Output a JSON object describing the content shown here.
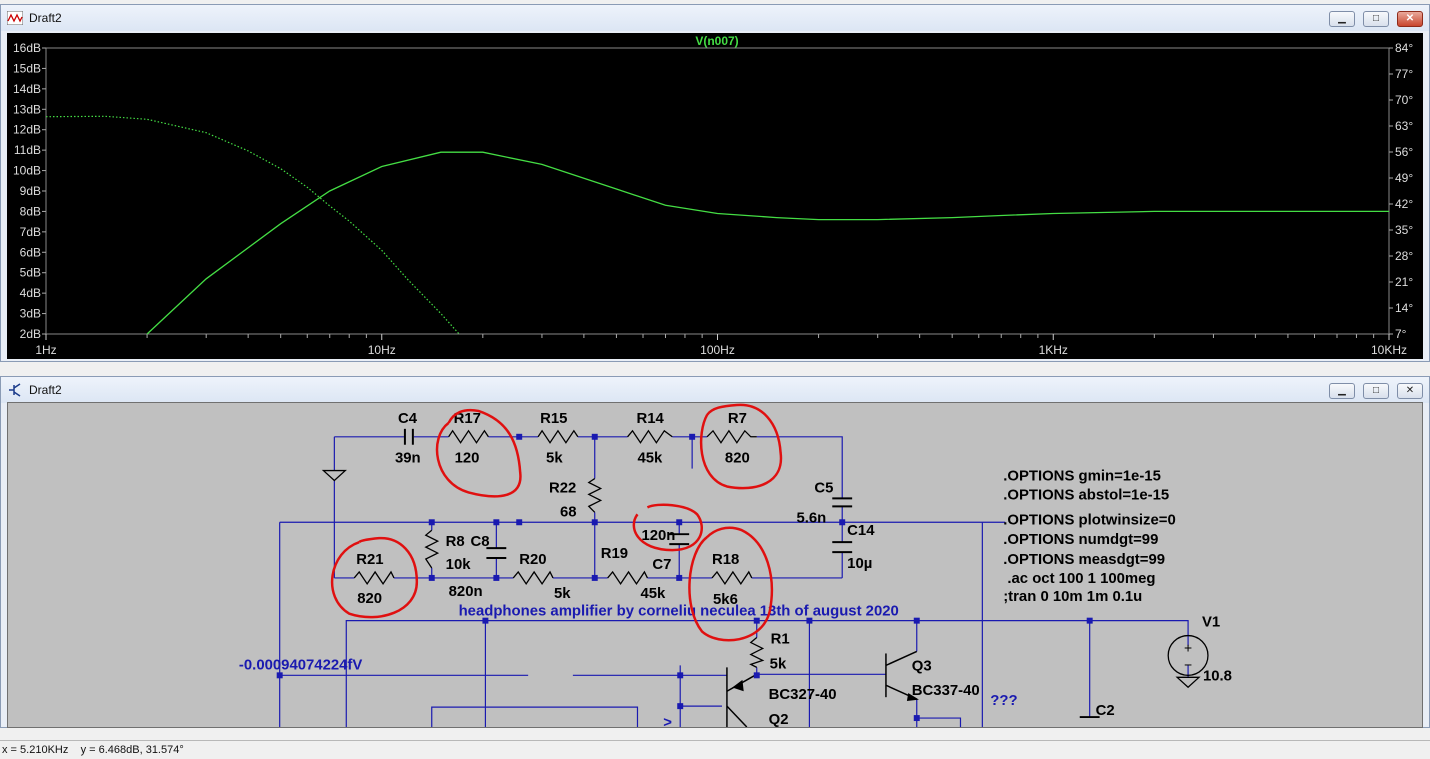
{
  "plot_window": {
    "title": "Draft2",
    "trace_label": "V(n007)",
    "buttons": [
      "minimize",
      "maximize",
      "close"
    ]
  },
  "schematic_window": {
    "title": "Draft2",
    "buttons": [
      "minimize",
      "maximize",
      "close"
    ]
  },
  "chart_data": {
    "type": "line",
    "title": "V(n007)",
    "xscale": "log",
    "x_ticks": [
      "1Hz",
      "10Hz",
      "100Hz",
      "1KHz",
      "10KHz"
    ],
    "y_left_ticks": [
      "16dB",
      "15dB",
      "14dB",
      "13dB",
      "12dB",
      "11dB",
      "10dB",
      "9dB",
      "8dB",
      "7dB",
      "6dB",
      "5dB",
      "4dB",
      "3dB",
      "2dB"
    ],
    "y_right_ticks": [
      "84°",
      "77°",
      "70°",
      "63°",
      "56°",
      "49°",
      "42°",
      "35°",
      "28°",
      "21°",
      "14°",
      "7°"
    ],
    "ylim_db": [
      2,
      16
    ],
    "ylim_phase": [
      7,
      84
    ],
    "series": [
      {
        "name": "magnitude",
        "color": "#44dd44",
        "x_hz": [
          2,
          3,
          5,
          7,
          10,
          15,
          20,
          30,
          50,
          70,
          100,
          150,
          200,
          300,
          500,
          700,
          1000,
          2000,
          5000,
          10000
        ],
        "y_db": [
          2.0,
          4.7,
          7.4,
          9.0,
          10.2,
          10.9,
          10.9,
          10.3,
          9.1,
          8.3,
          7.9,
          7.7,
          7.6,
          7.6,
          7.7,
          7.8,
          7.9,
          8.0,
          8.0,
          8.0
        ]
      },
      {
        "name": "phase",
        "color": "#44dd44",
        "dotted": true,
        "x_hz": [
          1,
          1.5,
          2,
          3,
          4,
          5,
          6,
          7,
          8,
          10,
          12,
          15,
          17
        ],
        "y_deg": [
          65.5,
          65.6,
          64.8,
          61.2,
          56.3,
          51.5,
          46.5,
          41.5,
          37.4,
          29.5,
          21.5,
          12.5,
          7.0
        ]
      }
    ]
  },
  "schematic": {
    "components": {
      "C4": {
        "name": "C4",
        "value": "39n"
      },
      "R17": {
        "name": "R17",
        "value": "120"
      },
      "R15": {
        "name": "R15",
        "value": "5k"
      },
      "R14": {
        "name": "R14",
        "value": "45k"
      },
      "R7": {
        "name": "R7",
        "value": "820"
      },
      "R22": {
        "name": "R22",
        "value": "68"
      },
      "C5": {
        "name": "C5",
        "value": "5.6n"
      },
      "C14": {
        "name": "C14",
        "value": "10µ"
      },
      "R8": {
        "name": "R8",
        "value": "10k"
      },
      "C8": {
        "name": "C8",
        "value": "820n"
      },
      "R20": {
        "name": "R20",
        "value": "5k"
      },
      "R19": {
        "name": "R19",
        "value": "45k"
      },
      "C7": {
        "name": "C7",
        "value": "120n"
      },
      "R18": {
        "name": "R18",
        "value": "5k6"
      },
      "R21": {
        "name": "R21",
        "value": "820"
      },
      "R1": {
        "name": "R1",
        "value": "5k"
      },
      "Q2": {
        "name": "Q2",
        "value": "BC327-40"
      },
      "Q3": {
        "name": "Q3",
        "value": "BC337-40"
      },
      "V1": {
        "name": "V1",
        "value": "10.8"
      },
      "C2": {
        "name": "C2"
      }
    },
    "directives": [
      ".OPTIONS gmin=1e-15",
      ".OPTIONS abstol=1e-15",
      ".OPTIONS plotwinsize=0",
      ".OPTIONS numdgt=99",
      ".OPTIONS measdgt=99",
      " .ac oct 100 1 100meg",
      ";tran 0 10m 1m 0.1u"
    ],
    "comment": "headphones amplifier by corneliu neculea 13th of august 2020",
    "node_voltage": "-0.00094074224fV",
    "unknown_mark": "???"
  },
  "status_bar": {
    "text": "x = 5.210KHz    y = 6.468dB, 31.574°"
  }
}
